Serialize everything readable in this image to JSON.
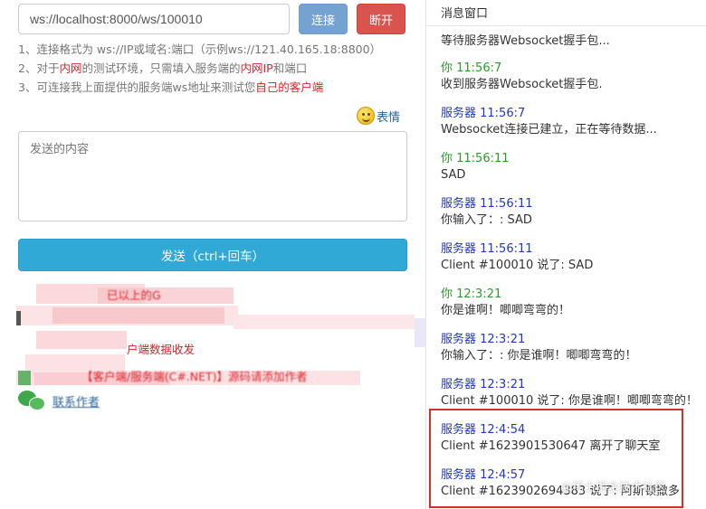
{
  "connection": {
    "url_value": "ws://localhost:8000/ws/100010",
    "connect_label": "连接",
    "disconnect_label": "断开"
  },
  "tips": {
    "line1": "1、连接格式为 ws://IP或域名:端口（示例ws://121.40.165.18:8800）",
    "line2_a": "2、对于",
    "line2_b": "内网",
    "line2_c": "的测试环境，只需填入服务端的",
    "line2_d": "内网IP",
    "line2_e": "和端口",
    "line3_a": "3、可连接我上面提供的服务端ws地址来测试您",
    "line3_b": "自己的客户端"
  },
  "emoji": {
    "label": "表情",
    "icon": "smiley-icon"
  },
  "send": {
    "placeholder": "发送的内容",
    "button_label": "发送（ctrl+回车）"
  },
  "blurred": {
    "fragment1": "已以上的G",
    "fragment2": "户端数据收发",
    "fragment3": "【客户端/服务端(C#.NET)】源码请添加作者",
    "contact_label": "联系作者"
  },
  "panel": {
    "title": "消息窗口",
    "messages": [
      {
        "label": "",
        "text": "等待服务器Websocket握手包..."
      },
      {
        "label": "你 11:56:7",
        "text": "收到服务器Websocket握手包."
      },
      {
        "label": "服务器 11:56:7",
        "text": "Websocket连接已建立，正在等待数据..."
      },
      {
        "label": "你 11:56:11",
        "text": "SAD"
      },
      {
        "label": "服务器 11:56:11",
        "text": "你输入了：: SAD"
      },
      {
        "label": "服务器 11:56:11",
        "text": "Client #100010 说了: SAD"
      },
      {
        "label": "你 12:3:21",
        "text": "你是谁啊！唧唧弯弯的！"
      },
      {
        "label": "服务器 12:3:21",
        "text": "你输入了：: 你是谁啊！唧唧弯弯的！"
      },
      {
        "label": "服务器 12:3:21",
        "text": "Client #100010 说了: 你是谁啊！唧唧弯弯的！"
      },
      {
        "label": "服务器 12:4:54",
        "text": "Client #1623901530647 离开了聊天室"
      },
      {
        "label": "服务器 12:4:57",
        "text": "Client #1623902694383 说了: 阿斯顿撒多"
      }
    ],
    "watermark": "@稀土掘金技术社区"
  },
  "colors": {
    "connect_btn": "#74a2d1",
    "disconnect_btn": "#d9534f",
    "send_btn": "#31a9d7",
    "you_label": "#2a9a2a",
    "server_label": "#2236c4",
    "highlight": "#d32f2f",
    "tip_red": "#d9232a"
  }
}
